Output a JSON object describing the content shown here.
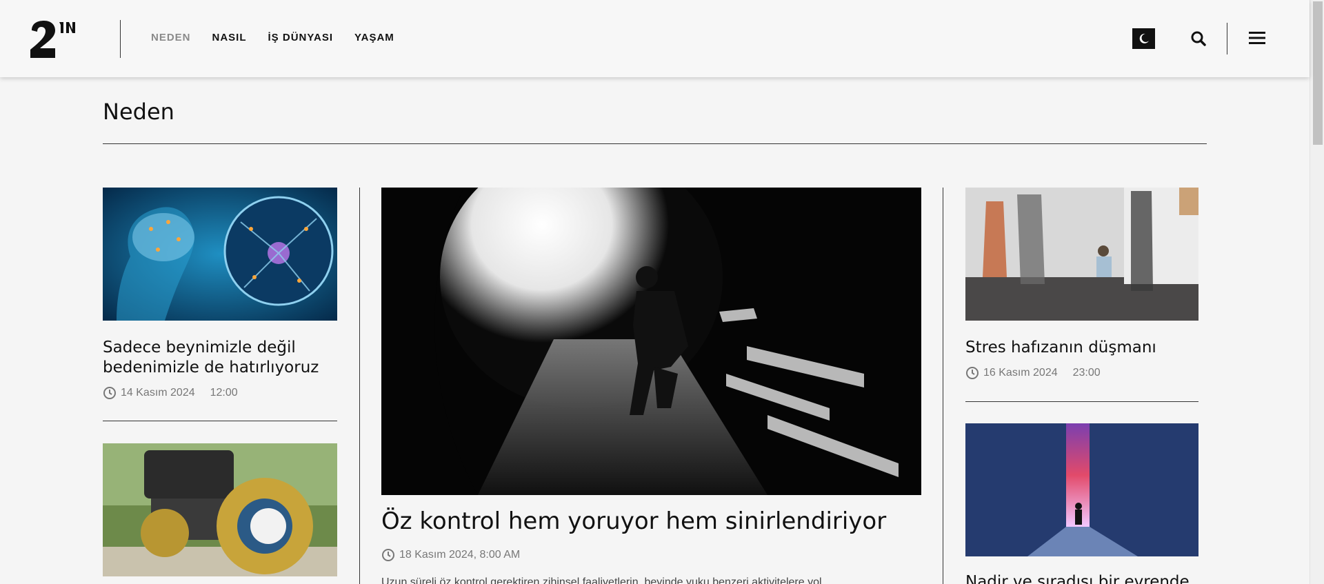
{
  "header": {
    "nav": [
      "NEDEN",
      "NASIL",
      "İŞ DÜNYASI",
      "YAŞAM"
    ],
    "active_nav": "NEDEN"
  },
  "section": {
    "title": "Neden"
  },
  "left_column": {
    "articles": [
      {
        "title": "Sadece beynimizle değil bedenimizle de hatırlıyoruz",
        "date": "14 Kasım 2024",
        "time": "12:00"
      }
    ]
  },
  "feature": {
    "title": "Öz kontrol hem yoruyor hem sinirlendiriyor",
    "datetime": "18 Kasım 2024, 8:00 AM",
    "excerpt": "Uzun süreli öz kontrol gerektiren zihinsel faaliyetlerin, beyinde yuku benzeri aktivitelere yol"
  },
  "right_column": {
    "articles": [
      {
        "title": "Stres hafızanın düşmanı",
        "date": "16 Kasım 2024",
        "time": "23:00"
      },
      {
        "title": "Nadir ve sıradışı bir evrende"
      }
    ]
  },
  "colors": {
    "text": "#111111",
    "meta": "#777777",
    "background": "#f5f5f5"
  }
}
